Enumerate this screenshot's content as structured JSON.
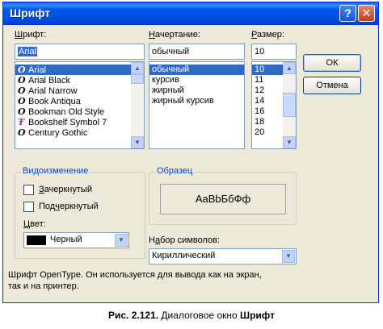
{
  "window": {
    "title": "Шрифт",
    "help": "?",
    "close": "✕"
  },
  "font": {
    "label_pre": "",
    "label_u": "Ш",
    "label_post": "рифт:",
    "value": "Arial",
    "items": [
      "Arial",
      "Arial Black",
      "Arial Narrow",
      "Book Antiqua",
      "Bookman Old Style",
      "Bookshelf Symbol 7",
      "Century Gothic"
    ],
    "icon_o": "O",
    "icon_tt": "Ŧ"
  },
  "style": {
    "label_pre": "",
    "label_u": "Н",
    "label_post": "ачертание:",
    "value": "обычный",
    "items": [
      "обычный",
      "курсив",
      "жирный",
      "жирный курсив"
    ]
  },
  "size": {
    "label_pre": "",
    "label_u": "Р",
    "label_post": "азмер:",
    "value": "10",
    "items": [
      "10",
      "11",
      "12",
      "14",
      "16",
      "18",
      "20"
    ]
  },
  "buttons": {
    "ok": "ОК",
    "cancel": "Отмена"
  },
  "effects": {
    "legend": "Видоизменение",
    "strike_u": "З",
    "strike_post": "ачеркнутый",
    "underline_pre": "Под",
    "underline_u": "ч",
    "underline_post": "еркнутый",
    "color_label_pre": "",
    "color_label_u": "Ц",
    "color_label_post": "вет:",
    "color_value": "Черный"
  },
  "sample": {
    "legend": "Образец",
    "text": "AaBbБбФф"
  },
  "charset": {
    "label_pre": "Н",
    "label_u": "а",
    "label_post": "бор символов:",
    "value": "Кириллический"
  },
  "description": [
    "Шрифт OpenType. Он используется для вывода как на экран,",
    "так и на принтер."
  ],
  "caption": {
    "prefix": "Рис. 2.121.",
    "text": " Диалоговое окно ",
    "bold": "Шрифт"
  },
  "colors": {
    "titlebar": "#0058ee",
    "selection": "#316ac5",
    "group_label": "#0046d5",
    "dialog_bg": "#ece9d8"
  }
}
